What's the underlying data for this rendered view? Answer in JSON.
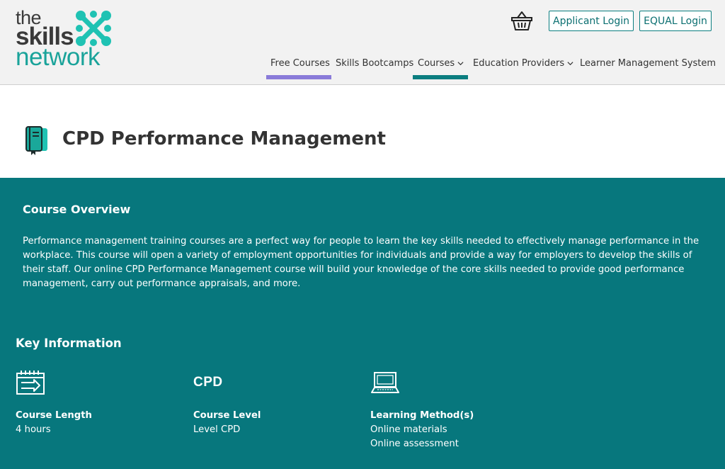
{
  "logo": {
    "line1": "the",
    "line2": "skills",
    "line3": "network"
  },
  "header": {
    "applicant_login": "Applicant Login",
    "equal_login": "EQUAL Login",
    "nav": [
      {
        "label": "Free Courses"
      },
      {
        "label": "Skills Bootcamps"
      },
      {
        "label": "Courses"
      },
      {
        "label": "Education Providers"
      },
      {
        "label": "Learner Management System"
      }
    ]
  },
  "page": {
    "title": "CPD Performance Management"
  },
  "overview": {
    "heading": "Course Overview",
    "text": "Performance management training courses are a perfect way for people to learn the key skills needed to effectively manage performance in the workplace. This course will open a variety of employment opportunities for individuals and provide a way for employers to develop the skills of their staff. Our online CPD Performance Management course will build your knowledge of the core skills needed to provide good performance management, carry out performance appraisals, and more."
  },
  "key_info": {
    "heading": "Key Information",
    "items": [
      {
        "label": "Course Length",
        "values": [
          "4 hours"
        ]
      },
      {
        "label": "Course Level",
        "icon_text": "CPD",
        "values": [
          "Level CPD"
        ]
      },
      {
        "label": "Learning Method(s)",
        "values": [
          "Online materials",
          "Online assessment"
        ]
      }
    ]
  },
  "colors": {
    "teal": "#07777d",
    "brand_green": "#1fc2b3",
    "free_courses_underline": "#8a7bd9",
    "courses_underline": "#0b7e80"
  }
}
